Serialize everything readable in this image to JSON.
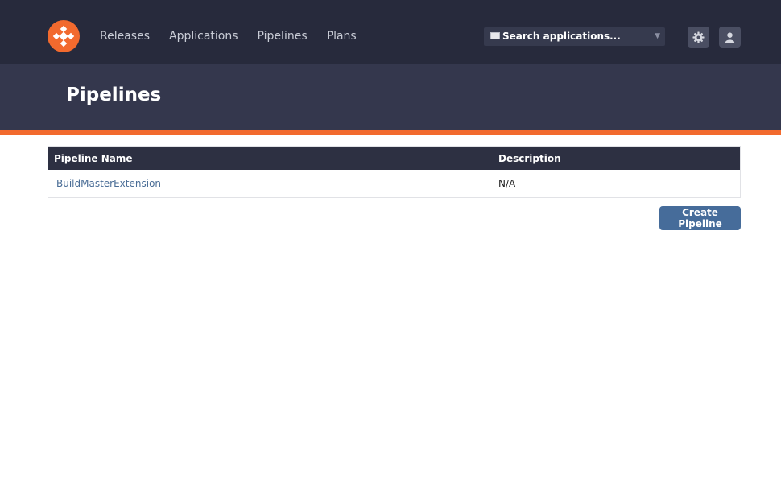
{
  "nav": {
    "items": [
      {
        "label": "Releases"
      },
      {
        "label": "Applications"
      },
      {
        "label": "Pipelines"
      },
      {
        "label": "Plans"
      }
    ]
  },
  "search": {
    "placeholder": "Search applications..."
  },
  "icons": {
    "logo": "buildmaster-logo-icon",
    "settings": "gear-icon",
    "user": "user-icon",
    "search_box": "window-icon"
  },
  "page": {
    "title": "Pipelines"
  },
  "table": {
    "headers": [
      "Pipeline Name",
      "Description"
    ],
    "rows": [
      {
        "name": "BuildMasterExtension",
        "description": "N/A"
      }
    ]
  },
  "actions": {
    "create_label": "Create Pipeline"
  },
  "colors": {
    "accent": "#f26a2e",
    "topbar": "#272a3c",
    "header": "#34374d",
    "button": "#466c9a"
  }
}
